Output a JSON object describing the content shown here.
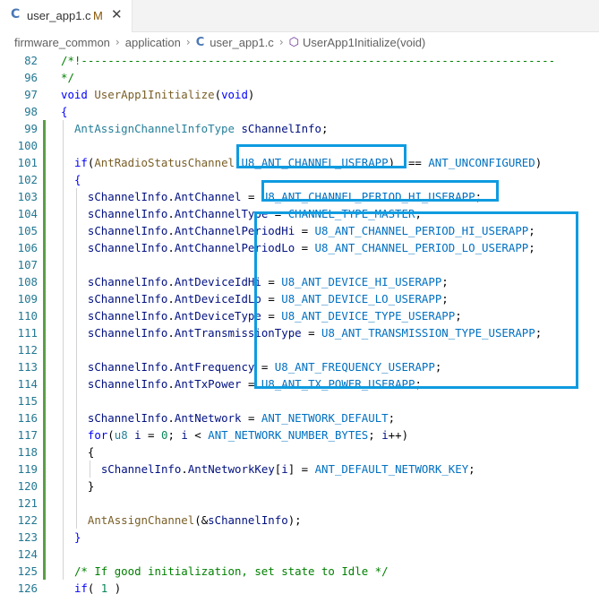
{
  "tab": {
    "filename": "user_app1.c",
    "lang_icon": "C",
    "modified_marker": "M",
    "close_icon": "✕"
  },
  "breadcrumb": {
    "items": [
      "firmware_common",
      "application",
      "user_app1.c",
      "UserApp1Initialize(void)"
    ],
    "file_icon": "C",
    "symbol_icon": "⬡",
    "separator": "›"
  },
  "colors": {
    "highlight_box": "#0e9be0",
    "git_added_bar": "#5b9e46",
    "line_number": "#237893"
  },
  "code_lines": [
    {
      "num": "82",
      "indent": 0,
      "tokens": [
        {
          "t": "/*!-----------------------------------------------------------------------",
          "c": "comment"
        }
      ]
    },
    {
      "num": "96",
      "indent": 0,
      "tokens": [
        {
          "t": "*/",
          "c": "comment"
        }
      ]
    },
    {
      "num": "97",
      "indent": 0,
      "tokens": [
        {
          "t": "void ",
          "c": "kw"
        },
        {
          "t": "UserApp1Initialize",
          "c": "fn"
        },
        {
          "t": "(",
          "c": "plain"
        },
        {
          "t": "void",
          "c": "kw"
        },
        {
          "t": ")",
          "c": "plain"
        }
      ]
    },
    {
      "num": "98",
      "indent": 0,
      "tokens": [
        {
          "t": "{",
          "c": "kw"
        }
      ]
    },
    {
      "num": "99",
      "indent": 2,
      "tokens": [
        {
          "t": "AntAssignChannelInfoType ",
          "c": "type"
        },
        {
          "t": "sChannelInfo",
          "c": "var"
        },
        {
          "t": ";",
          "c": "plain"
        }
      ]
    },
    {
      "num": "100",
      "indent": 0,
      "tokens": []
    },
    {
      "num": "101",
      "indent": 2,
      "tokens": [
        {
          "t": "if",
          "c": "kw"
        },
        {
          "t": "(",
          "c": "plain"
        },
        {
          "t": "AntRadioStatusChannel",
          "c": "fn"
        },
        {
          "t": "(",
          "c": "plain"
        },
        {
          "t": "U8_ANT_CHANNEL_USERAPP",
          "c": "macro"
        },
        {
          "t": ")  == ",
          "c": "plain"
        },
        {
          "t": "ANT_UNCONFIGURED",
          "c": "macro"
        },
        {
          "t": ")",
          "c": "plain"
        }
      ]
    },
    {
      "num": "102",
      "indent": 2,
      "tokens": [
        {
          "t": "{",
          "c": "kw"
        }
      ]
    },
    {
      "num": "103",
      "indent": 4,
      "tokens": [
        {
          "t": "sChannelInfo",
          "c": "var"
        },
        {
          "t": ".",
          "c": "plain"
        },
        {
          "t": "AntChannel",
          "c": "var"
        },
        {
          "t": " = ",
          "c": "plain"
        },
        {
          "t": "U8_ANT_CHANNEL_PERIOD_HI_USERAPP",
          "c": "macro"
        },
        {
          "t": ";",
          "c": "plain"
        }
      ]
    },
    {
      "num": "104",
      "indent": 4,
      "tokens": [
        {
          "t": "sChannelInfo",
          "c": "var"
        },
        {
          "t": ".",
          "c": "plain"
        },
        {
          "t": "AntChannelType",
          "c": "var"
        },
        {
          "t": " = ",
          "c": "plain"
        },
        {
          "t": "CHANNEL_TYPE_MASTER",
          "c": "macro"
        },
        {
          "t": ";",
          "c": "plain"
        }
      ]
    },
    {
      "num": "105",
      "indent": 4,
      "tokens": [
        {
          "t": "sChannelInfo",
          "c": "var"
        },
        {
          "t": ".",
          "c": "plain"
        },
        {
          "t": "AntChannelPeriodHi",
          "c": "var"
        },
        {
          "t": " = ",
          "c": "plain"
        },
        {
          "t": "U8_ANT_CHANNEL_PERIOD_HI_USERAPP",
          "c": "macro"
        },
        {
          "t": ";",
          "c": "plain"
        }
      ]
    },
    {
      "num": "106",
      "indent": 4,
      "tokens": [
        {
          "t": "sChannelInfo",
          "c": "var"
        },
        {
          "t": ".",
          "c": "plain"
        },
        {
          "t": "AntChannelPeriodLo",
          "c": "var"
        },
        {
          "t": " = ",
          "c": "plain"
        },
        {
          "t": "U8_ANT_CHANNEL_PERIOD_LO_USERAPP",
          "c": "macro"
        },
        {
          "t": ";",
          "c": "plain"
        }
      ]
    },
    {
      "num": "107",
      "indent": 0,
      "tokens": []
    },
    {
      "num": "108",
      "indent": 4,
      "tokens": [
        {
          "t": "sChannelInfo",
          "c": "var"
        },
        {
          "t": ".",
          "c": "plain"
        },
        {
          "t": "AntDeviceIdHi",
          "c": "var"
        },
        {
          "t": " = ",
          "c": "plain"
        },
        {
          "t": "U8_ANT_DEVICE_HI_USERAPP",
          "c": "macro"
        },
        {
          "t": ";",
          "c": "plain"
        }
      ]
    },
    {
      "num": "109",
      "indent": 4,
      "tokens": [
        {
          "t": "sChannelInfo",
          "c": "var"
        },
        {
          "t": ".",
          "c": "plain"
        },
        {
          "t": "AntDeviceIdLo",
          "c": "var"
        },
        {
          "t": " = ",
          "c": "plain"
        },
        {
          "t": "U8_ANT_DEVICE_LO_USERAPP",
          "c": "macro"
        },
        {
          "t": ";",
          "c": "plain"
        }
      ]
    },
    {
      "num": "110",
      "indent": 4,
      "tokens": [
        {
          "t": "sChannelInfo",
          "c": "var"
        },
        {
          "t": ".",
          "c": "plain"
        },
        {
          "t": "AntDeviceType",
          "c": "var"
        },
        {
          "t": " = ",
          "c": "plain"
        },
        {
          "t": "U8_ANT_DEVICE_TYPE_USERAPP",
          "c": "macro"
        },
        {
          "t": ";",
          "c": "plain"
        }
      ]
    },
    {
      "num": "111",
      "indent": 4,
      "tokens": [
        {
          "t": "sChannelInfo",
          "c": "var"
        },
        {
          "t": ".",
          "c": "plain"
        },
        {
          "t": "AntTransmissionType",
          "c": "var"
        },
        {
          "t": " = ",
          "c": "plain"
        },
        {
          "t": "U8_ANT_TRANSMISSION_TYPE_USERAPP",
          "c": "macro"
        },
        {
          "t": ";",
          "c": "plain"
        }
      ]
    },
    {
      "num": "112",
      "indent": 0,
      "tokens": []
    },
    {
      "num": "113",
      "indent": 4,
      "tokens": [
        {
          "t": "sChannelInfo",
          "c": "var"
        },
        {
          "t": ".",
          "c": "plain"
        },
        {
          "t": "AntFrequency",
          "c": "var"
        },
        {
          "t": " = ",
          "c": "plain"
        },
        {
          "t": "U8_ANT_FREQUENCY_USERAPP",
          "c": "macro"
        },
        {
          "t": ";",
          "c": "plain"
        }
      ]
    },
    {
      "num": "114",
      "indent": 4,
      "tokens": [
        {
          "t": "sChannelInfo",
          "c": "var"
        },
        {
          "t": ".",
          "c": "plain"
        },
        {
          "t": "AntTxPower",
          "c": "var"
        },
        {
          "t": " = ",
          "c": "plain"
        },
        {
          "t": "U8_ANT_TX_POWER_USERAPP",
          "c": "macro"
        },
        {
          "t": ";",
          "c": "plain"
        }
      ]
    },
    {
      "num": "115",
      "indent": 0,
      "tokens": []
    },
    {
      "num": "116",
      "indent": 4,
      "tokens": [
        {
          "t": "sChannelInfo",
          "c": "var"
        },
        {
          "t": ".",
          "c": "plain"
        },
        {
          "t": "AntNetwork",
          "c": "var"
        },
        {
          "t": " = ",
          "c": "plain"
        },
        {
          "t": "ANT_NETWORK_DEFAULT",
          "c": "macro"
        },
        {
          "t": ";",
          "c": "plain"
        }
      ]
    },
    {
      "num": "117",
      "indent": 4,
      "tokens": [
        {
          "t": "for",
          "c": "kw"
        },
        {
          "t": "(",
          "c": "plain"
        },
        {
          "t": "u8 ",
          "c": "type"
        },
        {
          "t": "i",
          "c": "var"
        },
        {
          "t": " = ",
          "c": "plain"
        },
        {
          "t": "0",
          "c": "num"
        },
        {
          "t": "; ",
          "c": "plain"
        },
        {
          "t": "i",
          "c": "var"
        },
        {
          "t": " < ",
          "c": "plain"
        },
        {
          "t": "ANT_NETWORK_NUMBER_BYTES",
          "c": "macro"
        },
        {
          "t": "; ",
          "c": "plain"
        },
        {
          "t": "i",
          "c": "var"
        },
        {
          "t": "++)",
          "c": "plain"
        }
      ]
    },
    {
      "num": "118",
      "indent": 4,
      "tokens": [
        {
          "t": "{",
          "c": "plain"
        }
      ]
    },
    {
      "num": "119",
      "indent": 6,
      "tokens": [
        {
          "t": "sChannelInfo",
          "c": "var"
        },
        {
          "t": ".",
          "c": "plain"
        },
        {
          "t": "AntNetworkKey",
          "c": "var"
        },
        {
          "t": "[",
          "c": "plain"
        },
        {
          "t": "i",
          "c": "var"
        },
        {
          "t": "] = ",
          "c": "plain"
        },
        {
          "t": "ANT_DEFAULT_NETWORK_KEY",
          "c": "macro"
        },
        {
          "t": ";",
          "c": "plain"
        }
      ]
    },
    {
      "num": "120",
      "indent": 4,
      "tokens": [
        {
          "t": "}",
          "c": "plain"
        }
      ]
    },
    {
      "num": "121",
      "indent": 0,
      "tokens": []
    },
    {
      "num": "122",
      "indent": 4,
      "tokens": [
        {
          "t": "AntAssignChannel",
          "c": "fn"
        },
        {
          "t": "(&",
          "c": "plain"
        },
        {
          "t": "sChannelInfo",
          "c": "var"
        },
        {
          "t": ");",
          "c": "plain"
        }
      ]
    },
    {
      "num": "123",
      "indent": 2,
      "tokens": [
        {
          "t": "}",
          "c": "kw"
        }
      ]
    },
    {
      "num": "124",
      "indent": 0,
      "tokens": []
    },
    {
      "num": "125",
      "indent": 2,
      "tokens": [
        {
          "t": "/* If good initialization, set state to Idle */",
          "c": "comment"
        }
      ]
    },
    {
      "num": "126",
      "indent": 2,
      "tokens": [
        {
          "t": "if",
          "c": "kw"
        },
        {
          "t": "( ",
          "c": "plain"
        },
        {
          "t": "1",
          "c": "num"
        },
        {
          "t": " )",
          "c": "plain"
        }
      ]
    }
  ]
}
